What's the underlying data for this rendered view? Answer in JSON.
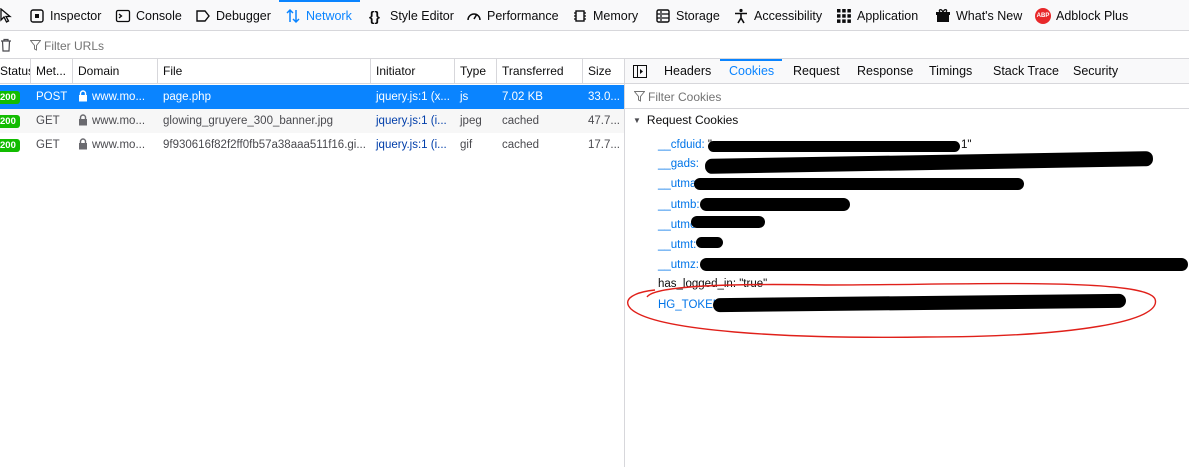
{
  "toolbar": {
    "tabs": [
      {
        "label": "Inspector",
        "icon": "inspector-icon"
      },
      {
        "label": "Console",
        "icon": "console-icon"
      },
      {
        "label": "Debugger",
        "icon": "debugger-icon"
      },
      {
        "label": "Network",
        "icon": "network-icon",
        "selected": true
      },
      {
        "label": "Style Editor",
        "icon": "style-editor-icon"
      },
      {
        "label": "Performance",
        "icon": "performance-icon"
      },
      {
        "label": "Memory",
        "icon": "memory-icon"
      },
      {
        "label": "Storage",
        "icon": "storage-icon"
      },
      {
        "label": "Accessibility",
        "icon": "accessibility-icon"
      },
      {
        "label": "Application",
        "icon": "application-icon"
      },
      {
        "label": "What's New",
        "icon": "whats-new-icon"
      },
      {
        "label": "Adblock Plus",
        "icon": "adblock-plus-icon"
      }
    ],
    "accent": "#0a84ff"
  },
  "filter": {
    "placeholder": "Filter URLs"
  },
  "request_list": {
    "columns": [
      "Status",
      "Met...",
      "Domain",
      "File",
      "Initiator",
      "Type",
      "Transferred",
      "Size"
    ],
    "rows": [
      {
        "status": "200",
        "method": "POST",
        "domain": "www.mo...",
        "file": "page.php",
        "initiator": "jquery.js:1 (x...",
        "type": "js",
        "transferred": "7.02 KB",
        "size": "33.0..."
      },
      {
        "status": "200",
        "method": "GET",
        "domain": "www.mo...",
        "file": "glowing_gruyere_300_banner.jpg",
        "initiator": "jquery.js:1 (i...",
        "type": "jpeg",
        "transferred": "cached",
        "size": "47.7..."
      },
      {
        "status": "200",
        "method": "GET",
        "domain": "www.mo...",
        "file": "9f930616f82f2ff0fb57a38aaa511f16.gi...",
        "initiator": "jquery.js:1 (i...",
        "type": "gif",
        "transferred": "cached",
        "size": "17.7..."
      }
    ],
    "status_color": "#12bc00"
  },
  "details": {
    "tabs": [
      "Headers",
      "Cookies",
      "Request",
      "Response",
      "Timings",
      "Stack Trace",
      "Security"
    ],
    "selected_tab": "Cookies",
    "filter_placeholder": "Filter Cookies",
    "section_title": "Request Cookies",
    "cookies": [
      {
        "name": "__cfduid:",
        "value": "\"",
        "tail": "1\""
      },
      {
        "name": "__gads:",
        "value": ""
      },
      {
        "name": "__utma:",
        "value": ""
      },
      {
        "name": "__utmb:",
        "value": ""
      },
      {
        "name": "__utmc:",
        "value": ""
      },
      {
        "name": "__utmt:",
        "value": ""
      },
      {
        "name": "__utmz:",
        "value": ""
      },
      {
        "name": "has_logged_in:",
        "value": "\"true\""
      },
      {
        "name": "HG_TOKEN:",
        "value": ""
      }
    ],
    "highlight_color": "#e0201a"
  }
}
